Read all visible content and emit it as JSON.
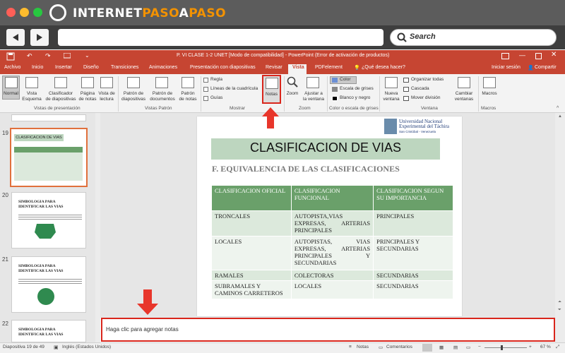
{
  "browser": {
    "logo_prefix": "INTERNET",
    "logo_middle": "PASO",
    "logo_a": "A",
    "logo_suffix": "PASO",
    "search_label": "Search"
  },
  "ppt": {
    "window_title": "P. VI  CLASE 1-2 UNET [Modo de compatibilidad] - PowerPoint (Error de activación de productos)",
    "tabs": [
      "Archivo",
      "Inicio",
      "Insertar",
      "Diseño",
      "Transiciones",
      "Animaciones",
      "Presentación con diapositivas",
      "Revisar",
      "Vista",
      "PDFelement"
    ],
    "tell_me": "¿Qué desea hacer?",
    "sign_in": "Iniciar sesión",
    "share": "Compartir",
    "ribbon": {
      "normal": "Normal",
      "vista_esquema": [
        "Vista",
        "Esquema"
      ],
      "clasificador": [
        "Clasificador",
        "de diapositivas"
      ],
      "pagina_notas": [
        "Página",
        "de notas"
      ],
      "vista_lectura": [
        "Vista de",
        "lectura"
      ],
      "patron_diapositivas": [
        "Patrón de",
        "diapositivas"
      ],
      "patron_documentos": [
        "Patrón de",
        "documentos"
      ],
      "patron_notas": [
        "Patrón",
        "de notas"
      ],
      "regla": "Regla",
      "lineas": "Líneas de la cuadrícula",
      "guias": "Guías",
      "notas": "Notas",
      "zoom": "Zoom",
      "ajustar": [
        "Ajustar a",
        "la ventana"
      ],
      "color": "Color",
      "escala_grises": "Escala de grises",
      "blanco_negro": "Blanco y negro",
      "nueva_ventana": [
        "Nueva",
        "ventana"
      ],
      "organizar": "Organizar todas",
      "cascada": "Cascada",
      "mover_division": "Mover división",
      "cambiar_ventanas": [
        "Cambiar",
        "ventanas"
      ],
      "macros": "Macros",
      "groups": [
        "Vistas de presentación",
        "Vistas Patrón",
        "Mostrar",
        "Zoom",
        "Color o escala de grises",
        "Ventana",
        "Macros"
      ]
    },
    "thumbnails": [
      {
        "num": "19",
        "title": "CLASIFICACION DE VIAS"
      },
      {
        "num": "20",
        "title": "SIMBOLOGIA PARA IDENTIFICAR LAS VIAS"
      },
      {
        "num": "21",
        "title": "SIMBOLOGIA PARA IDENTIFICAR LAS VIAS"
      },
      {
        "num": "22",
        "title": "SIMBOLOGIA PARA IDENTIFICAR LAS VIAS"
      }
    ],
    "slide": {
      "title": "CLASIFICACION DE VIAS",
      "subtitle": "F. EQUIVALENCIA DE LAS CLASIFICACIONES",
      "logo": [
        "Universidad Nacional",
        "Experimental del Táchira",
        "San Cristóbal - Venezuela"
      ],
      "table_headers": [
        "CLASIFICACION OFICIAL",
        "CLASIFICACION FUNCIONAL",
        "CLASIFICACION SEGUN SU IMPORTANCIA"
      ],
      "table_rows": [
        [
          "TRONCALES",
          "AUTOPISTA,VIAS EXPRESAS, ARTERIAS PRINCIPALES",
          "PRINCIPALES"
        ],
        [
          "LOCALES",
          "AUTOPISTAS, VIAS EXPRESAS, ARTERIAS PRINCIPALES Y SECUNDARIAS",
          "PRINCIPALES Y SECUNDARIAS"
        ],
        [
          "RAMALES",
          "COLECTORAS",
          "SECUNDARIAS"
        ],
        [
          "SUBRAMALES Y CAMINOS CARRETEROS",
          "LOCALES",
          "SECUNDARIAS"
        ]
      ]
    },
    "notes_placeholder": "Haga clic para agregar notas",
    "status": {
      "slide_info": "Diapositiva 19 de 49",
      "language": "Inglés (Estados Unidos)",
      "notes": "Notas",
      "comments": "Comentarios",
      "zoom": "67 %"
    }
  },
  "colors": {
    "accent": "#c64532",
    "highlight": "#d9261c",
    "table_header": "#6aa06a"
  }
}
